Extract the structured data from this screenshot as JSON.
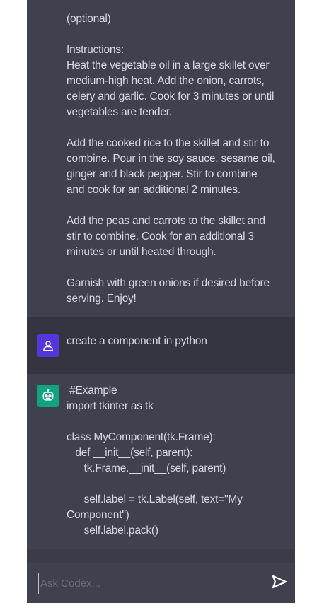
{
  "conversation": {
    "recipe_message": "Add the peas and carrots to the skillet and\nstir to combine. Cook for an additional 3\nminutes or until heated through.",
    "recipe_top": "(optional)\n\nInstructions:\nHeat the vegetable oil in a large skillet over\nmedium-high heat. Add the onion, carrots,\ncelery and garlic. Cook for 3 minutes or until\nvegetables are tender.\n\nAdd the cooked rice to the skillet and stir to\ncombine. Pour in the soy sauce, sesame oil,\nginger and black pepper. Stir to combine\nand cook for an additional 2 minutes.\n\nAdd the peas and carrots to the skillet and\nstir to combine. Cook for an additional 3\nminutes or until heated through.\n\nGarnish with green onions if desired before\nserving. Enjoy!",
    "user_message": "create a component in python",
    "code_message": " #Example\nimport tkinter as tk\n\nclass MyComponent(tk.Frame):\n   def __init__(self, parent):\n      tk.Frame.__init__(self, parent)\n\n      self.label = tk.Label(self, text=\"My\nComponent\")\n      self.label.pack()"
  },
  "input": {
    "placeholder": "Ask Codex..."
  },
  "icons": {
    "user_avatar": "user-icon",
    "bot_avatar": "robot-icon",
    "send": "send-icon"
  },
  "colors": {
    "user_avatar_bg": "#5436da",
    "bot_avatar_bg": "#10a37f"
  }
}
